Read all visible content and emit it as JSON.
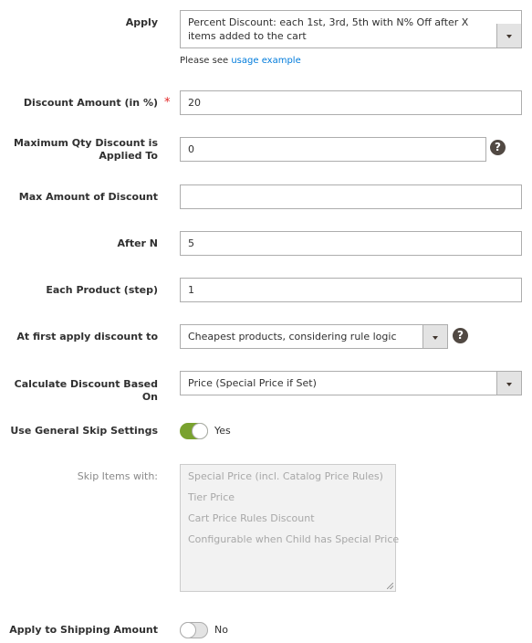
{
  "fields": {
    "apply": {
      "label": "Apply",
      "value": "Percent Discount: each 1st, 3rd, 5th with N% Off after X items added to the cart",
      "note_prefix": "Please see",
      "note_link": "usage example"
    },
    "discount_amount": {
      "label": "Discount Amount (in %)",
      "required_mark": "*",
      "value": "20"
    },
    "max_qty": {
      "label_line1": "Maximum Qty Discount is",
      "label_line2": "Applied To",
      "value": "0",
      "help": "?"
    },
    "max_amount": {
      "label": "Max Amount of Discount",
      "value": ""
    },
    "after_n": {
      "label": "After N",
      "value": "5"
    },
    "each_product": {
      "label": "Each Product (step)",
      "value": "1"
    },
    "first_apply": {
      "label": "At first apply discount to",
      "value": "Cheapest products, considering rule logic",
      "help": "?"
    },
    "calc_based": {
      "label": "Calculate Discount Based On",
      "value": "Price (Special Price if Set)"
    },
    "general_skip": {
      "label": "Use General Skip Settings",
      "state": "Yes",
      "on": true
    },
    "skip_items": {
      "label": "Skip Items with:",
      "options": [
        "Special Price (incl. Catalog Price Rules)",
        "Tier Price",
        "Cart Price Rules Discount",
        "Configurable when Child has Special Price"
      ]
    },
    "apply_shipping": {
      "label": "Apply to Shipping Amount",
      "state": "No",
      "on": false
    }
  },
  "colors": {
    "toggle_on": "#79a22e",
    "link": "#007bdb",
    "required": "#e22626",
    "help_icon": "#514943"
  }
}
